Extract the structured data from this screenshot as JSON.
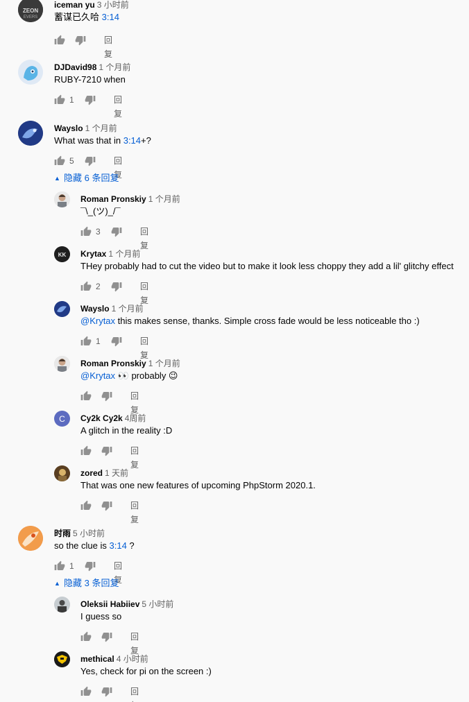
{
  "ui": {
    "reply_label": "回复"
  },
  "comments": [
    {
      "author": "iceman yu",
      "time": "3 小时前",
      "text_pre": "蓄谋已久哈 ",
      "link": "3:14",
      "text_post": "",
      "likes": ""
    },
    {
      "author": "DJDavid98",
      "time": "1 个月前",
      "text": "RUBY-7210 when",
      "likes": "1"
    },
    {
      "author": "Wayslo",
      "time": "1 个月前",
      "text_pre": "What was that in ",
      "link": "3:14",
      "text_post": "+?",
      "likes": "5",
      "toggle": "隐藏 6 条回复"
    },
    {
      "author": "时雨",
      "time": "5 小时前",
      "text_pre": "so the clue is ",
      "link": "3:14",
      "text_post": " ?",
      "likes": "1",
      "toggle": "隐藏 3 条回复"
    }
  ],
  "replies": [
    {
      "author": "Roman Pronskiy",
      "time": "1 个月前",
      "text": "¯\\_(ツ)_/¯",
      "likes": "3"
    },
    {
      "author": "Krytax",
      "time": "1 个月前",
      "text": "THey probably had to cut the video but to make it look less choppy they add a lil' glitchy effect",
      "likes": "2"
    },
    {
      "author": "Wayslo",
      "time": "1 个月前",
      "mention": "@Krytax",
      "text": " this makes sense, thanks. Simple cross fade would be less noticeable tho :)",
      "likes": "1"
    },
    {
      "author": "Roman Pronskiy",
      "time": "1 个月前",
      "mention": "@Krytax",
      "text": " 👀 probably 😉",
      "likes": ""
    },
    {
      "author": "Cy2k Cy2k",
      "time": "4周前",
      "text": "A glitch in the reality :D",
      "likes": "",
      "avatar_letter": "C"
    },
    {
      "author": "zored",
      "time": "1 天前",
      "text": "That was one new features of upcoming PhpStorm 2020.1.",
      "likes": ""
    },
    {
      "author": "Oleksii Habiiev",
      "time": "5 小时前",
      "text": "I guess so",
      "likes": ""
    },
    {
      "author": "methical",
      "time": "4 小时前",
      "text": "Yes, check for pi on the screen :)",
      "likes": ""
    }
  ],
  "colors": {
    "link": "#065fd4",
    "meta": "#606060",
    "background": "#f9f9f9"
  }
}
